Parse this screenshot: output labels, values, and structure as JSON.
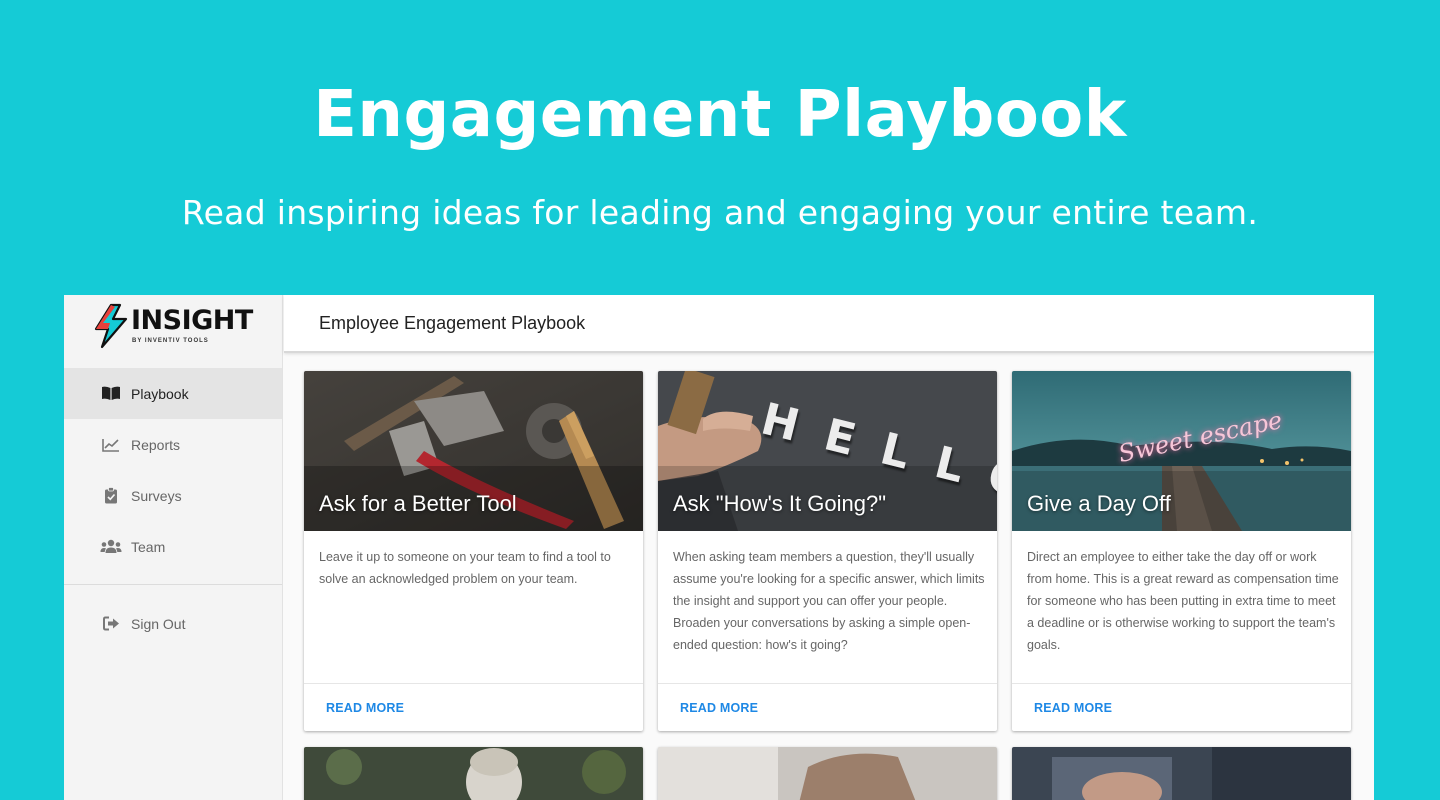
{
  "hero": {
    "title": "Engagement Playbook",
    "subtitle": "Read inspiring ideas for leading and engaging your entire team."
  },
  "brand": {
    "name": "INSIGHT",
    "tagline": "BY INVENTIV TOOLS"
  },
  "sidebar": {
    "items": [
      {
        "label": "Playbook",
        "icon": "book-icon",
        "active": true
      },
      {
        "label": "Reports",
        "icon": "chart-line-icon",
        "active": false
      },
      {
        "label": "Surveys",
        "icon": "clipboard-check-icon",
        "active": false
      },
      {
        "label": "Team",
        "icon": "users-icon",
        "active": false
      }
    ],
    "sign_out": {
      "label": "Sign Out",
      "icon": "sign-out-icon"
    }
  },
  "header": {
    "title": "Employee Engagement Playbook"
  },
  "cards": [
    {
      "title": "Ask for a Better Tool",
      "description": "Leave it up to someone on your team to find a tool to solve an acknowledged problem on your team.",
      "action": "READ MORE"
    },
    {
      "title": "Ask \"How's It Going?\"",
      "description": "When asking team members a question, they'll usually assume you're looking for a specific answer, which limits the insight and support you can offer your people. Broaden your conversations by asking a simple open-ended question: how's it going?",
      "action": "READ MORE",
      "image_text": "HELLO"
    },
    {
      "title": "Give a Day Off",
      "description": "Direct an employee to either take the day off or work from home. This is a great reward as compensation time for someone who has been putting in extra time to meet a deadline or is otherwise working to support the team's goals.",
      "action": "READ MORE",
      "image_text": "Sweet escape"
    }
  ],
  "colors": {
    "background": "#15cbd6",
    "accent": "#1e88e5",
    "brand_bolt_red": "#e8413c",
    "brand_bolt_teal": "#15cbd6"
  }
}
